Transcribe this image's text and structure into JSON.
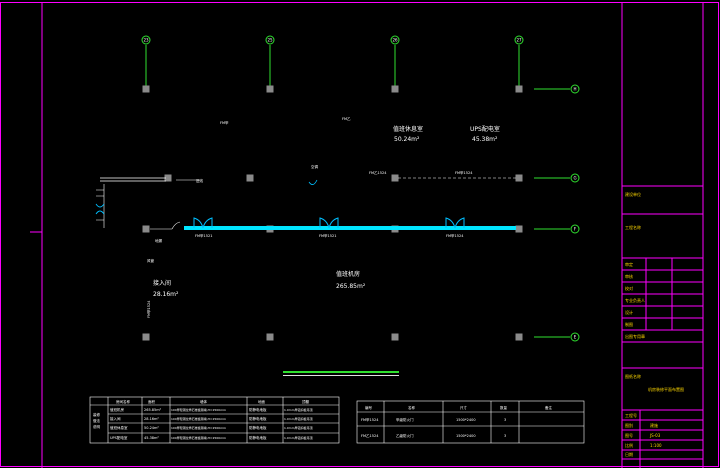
{
  "axes_top": [
    "23",
    "25",
    "26",
    "27"
  ],
  "axes_right": [
    "H",
    "G",
    "F",
    "E"
  ],
  "rooms": [
    {
      "name": "值班休息室",
      "area": "50.24m²"
    },
    {
      "name": "UPS配电室",
      "area": "45.38m²"
    },
    {
      "name": "值班机房",
      "area": "265.85m²"
    },
    {
      "name": "接入间",
      "area": "28.16m²"
    }
  ],
  "small_labels": {
    "lbl_a": "FM甲",
    "lbl_b": "FM乙",
    "lbl_c": "FM乙1524",
    "lbl_d": "FM甲1524",
    "lbl_e": "FM甲1521",
    "lbl_f": "FM甲1521",
    "lbl_g": "FM甲1524",
    "lbl_h": "空调",
    "lbl_i": "地漏",
    "lbl_j": "FM甲1524",
    "lbl_k": "风管",
    "lbl_l": "进线"
  },
  "room_table": {
    "headers": [
      "房间名称",
      "面积",
      "墙体",
      "地面",
      "顶棚"
    ],
    "side_label": [
      "装修",
      "做法",
      "说明"
    ],
    "rows": [
      [
        "值班机房",
        "265.85m²",
        "100厚轻钢龙骨石膏板隔墙,H=2500mm",
        "防静电地板",
        "1.0mm厚铝扣板吊顶"
      ],
      [
        "接入间",
        "28.16m²",
        "100厚轻钢龙骨石膏板隔墙,H=2500mm",
        "防静电地板",
        "1.0mm厚铝扣板吊顶"
      ],
      [
        "值班休息室",
        "50.24m²",
        "100厚轻钢龙骨石膏板隔墙,H=2500mm",
        "防静电地板",
        "1.0mm厚铝扣板吊顶"
      ],
      [
        "UPS配电室",
        "45.38m²",
        "100厚轻钢龙骨石膏板隔墙,H=2500mm",
        "防静电地板",
        "1.0mm厚铝扣板吊顶"
      ]
    ]
  },
  "door_table": {
    "headers": [
      "编号",
      "名称",
      "尺寸",
      "数量",
      "备注"
    ],
    "rows": [
      [
        "FM甲1524",
        "甲级防火门",
        "1500*2400",
        "3",
        ""
      ],
      [
        "FM乙1524",
        "乙级防火门",
        "1500*2400",
        "3",
        ""
      ]
    ]
  },
  "title_block": {
    "field_1": "建设单位",
    "field_2": "工程名称",
    "sign_rows": [
      "审定",
      "审核",
      "校对",
      "专业负责人",
      "设计",
      "制图"
    ],
    "stamp": "出图专用章",
    "drawing_name_label": "图纸名称",
    "drawing_name": "机房装修平面布置图",
    "bottom_rows": [
      {
        "k": "工程号",
        "v": ""
      },
      {
        "k": "图别",
        "v": "建施"
      },
      {
        "k": "图号",
        "v": "JS-03"
      },
      {
        "k": "比例",
        "v": "1:100"
      },
      {
        "k": "日期",
        "v": ""
      }
    ]
  },
  "colors": {
    "frame": "#ff00ff",
    "axis": "#2fe02f",
    "wall": "#00e5ff",
    "door": "#00bfff",
    "column": "#8a8a8a",
    "text": "#ffffff",
    "accent": "#ffd800"
  }
}
